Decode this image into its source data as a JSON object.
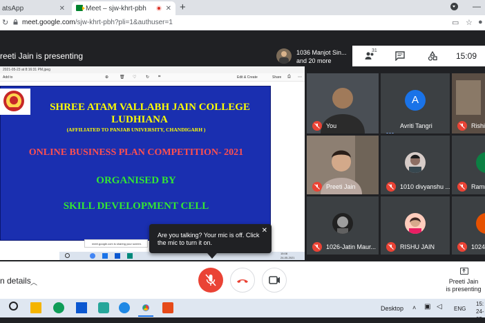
{
  "browser": {
    "tabs": [
      {
        "title": "atsApp",
        "active": false
      },
      {
        "title": "Meet – sjw-khrt-pbh",
        "active": true
      }
    ],
    "new_tab": "+",
    "url_domain": "meet.google.com",
    "url_path": "/sjw-khrt-pbh?pli=1&authuser=1"
  },
  "meet": {
    "presenter_label": "reeti Jain is presenting",
    "people_summary_line1": "1036 Manjot Sin...",
    "people_summary_line2": "and 20 more",
    "people_count": "31",
    "clock": "15:09",
    "shared_screen": {
      "file_caption": "2021-05-23 at 8:16:31 PM.jpeg",
      "toolbar_add": "Add to",
      "toolbar_edit": "Edit & Create",
      "toolbar_share": "Share",
      "slide": {
        "line1": "SHREE ATAM VALLABH JAIN COLLEGE",
        "line2": "LUDHIANA",
        "line3": "(AFFILIATED TO PANJAB UNIVERSITY, CHANDIGARH )",
        "line4": "ONLINE BUSINESS PLAN  COMPETITION- 2021",
        "line5": "ORGANISED BY",
        "line6": "SKILL DEVELOPMENT CELL"
      },
      "sharing_notice": "meet.google.com is sharing your screen.",
      "mini_time": "15:08",
      "mini_date": "24-05-2021"
    },
    "tiles": [
      {
        "name": "You"
      },
      {
        "name": "Avriti Tangri",
        "initial": "A"
      },
      {
        "name": "Rishi"
      },
      {
        "name": "Preeti Jain"
      },
      {
        "name": "1010 divyanshu ..."
      },
      {
        "name": "Ramn"
      },
      {
        "name": "1026-Jatin Maur..."
      },
      {
        "name": "RISHU JAIN"
      },
      {
        "name": "1024"
      }
    ],
    "tooltip": "Are you talking? Your mic is off. Click the mic to turn it on.",
    "details_label": "n details",
    "presenting_status_line1": "Preeti Jain",
    "presenting_status_line2": "is presenting"
  },
  "taskbar": {
    "desktop_label": "Desktop",
    "lang": "ENG",
    "time": "15:",
    "date": "24-05"
  },
  "colors": {
    "mic_off_red": "#ea4335",
    "slide_blue": "#1a2fb0",
    "slide_yellow": "#ffff00",
    "slide_red": "#ff4d4d",
    "slide_green": "#33e633",
    "meet_dark": "#202124"
  }
}
